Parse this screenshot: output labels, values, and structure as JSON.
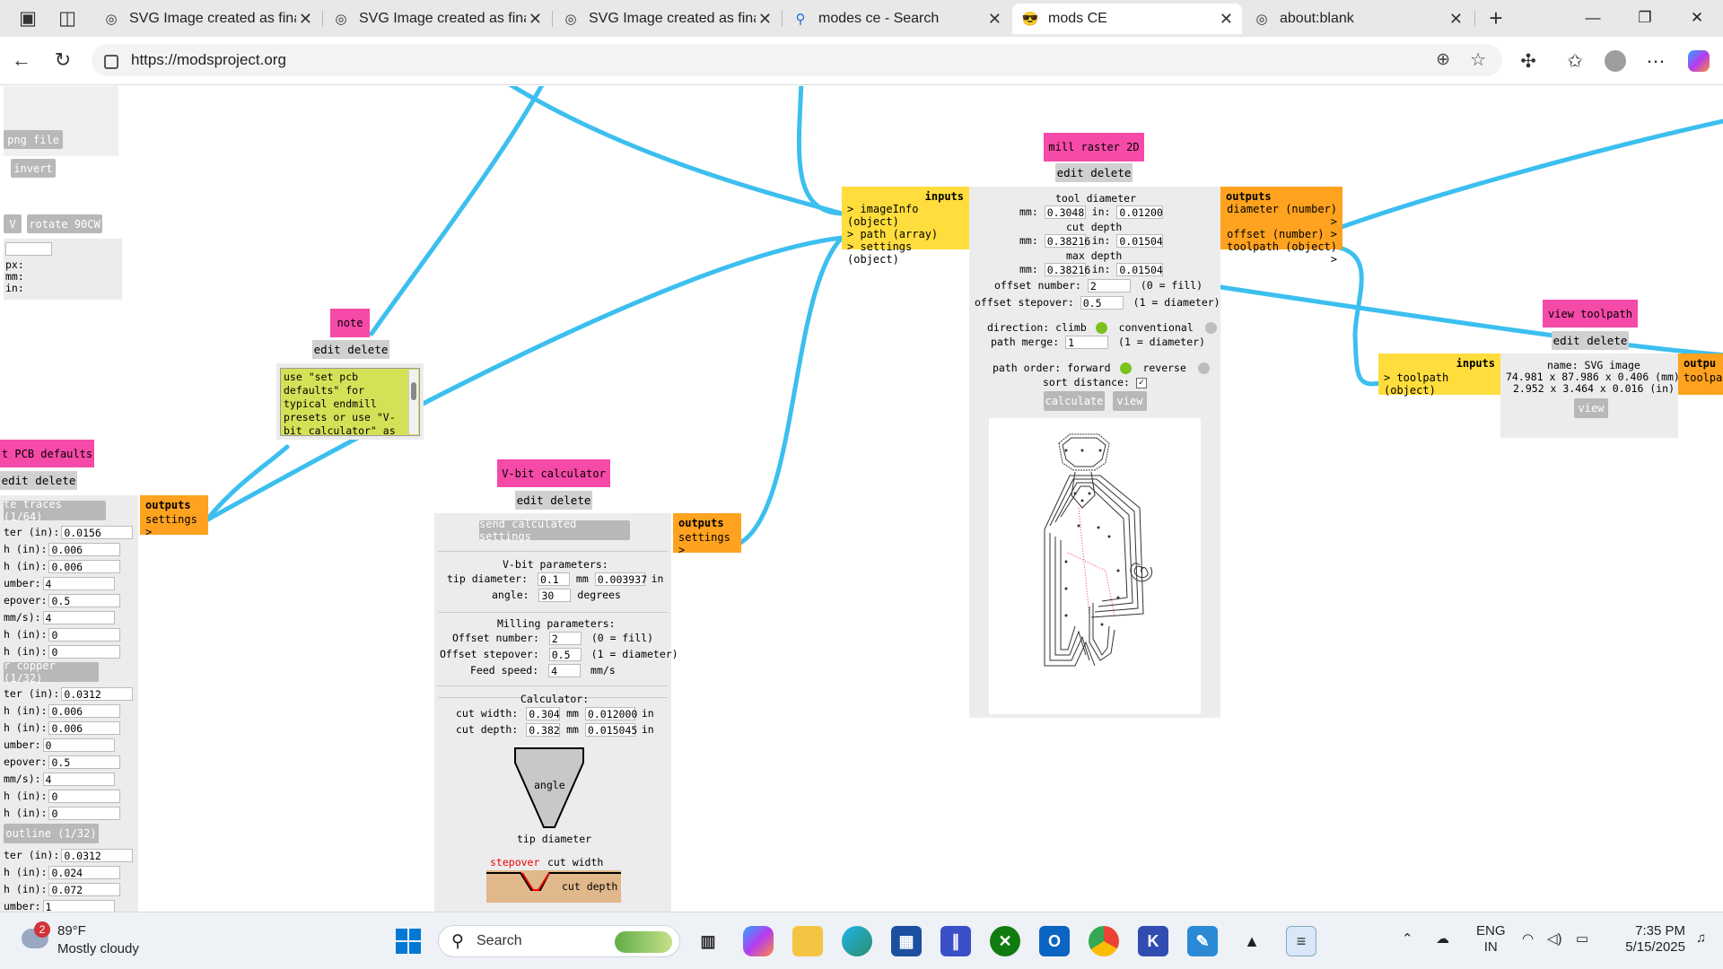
{
  "browser": {
    "tabs": [
      {
        "title": "SVG Image created as final",
        "icon": "globe-icon"
      },
      {
        "title": "SVG Image created as final",
        "icon": "globe-icon"
      },
      {
        "title": "SVG Image created as final",
        "icon": "globe-icon"
      },
      {
        "title": "modes ce - Search",
        "icon": "search-icon"
      },
      {
        "title": "mods CE",
        "icon": "sunglasses-emoji-icon",
        "active": true
      },
      {
        "title": "about:blank",
        "icon": "globe-icon"
      }
    ],
    "url": "https://modsproject.org",
    "window_controls": {
      "minimize": "—",
      "restore": "❐",
      "close": "✕"
    }
  },
  "left_partial": {
    "png_file": "png file",
    "invert": "invert",
    "v": "V",
    "rotate": "rotate 90CW",
    "units": [
      "px:",
      "mm:",
      "in:"
    ],
    "pcb_title": "t PCB defaults",
    "pcb_edit": "edit delete",
    "traces_btn": "te traces (1/64)",
    "copper_btn": "r copper (1/32)",
    "outline_btn": "outline (1/32)",
    "traces_rows": [
      {
        "label": "ter (in):",
        "value": "0.0156"
      },
      {
        "label": "h (in):",
        "value": "0.006"
      },
      {
        "label": "h (in):",
        "value": "0.006"
      },
      {
        "label": "umber:",
        "value": "4"
      },
      {
        "label": "epover:",
        "value": "0.5"
      },
      {
        "label": "mm/s):",
        "value": "4"
      },
      {
        "label": "h (in):",
        "value": "0"
      },
      {
        "label": "h (in):",
        "value": "0"
      }
    ],
    "copper_rows": [
      {
        "label": "ter (in):",
        "value": "0.0312"
      },
      {
        "label": "h (in):",
        "value": "0.006"
      },
      {
        "label": "h (in):",
        "value": "0.006"
      },
      {
        "label": "umber:",
        "value": "0"
      },
      {
        "label": "epover:",
        "value": "0.5"
      },
      {
        "label": "mm/s):",
        "value": "4"
      },
      {
        "label": "h (in):",
        "value": "0"
      },
      {
        "label": "h (in):",
        "value": "0"
      }
    ],
    "outline_rows": [
      {
        "label": "ter (in):",
        "value": "0.0312"
      },
      {
        "label": "h (in):",
        "value": "0.024"
      },
      {
        "label": "h (in):",
        "value": "0.072"
      },
      {
        "label": "umber:",
        "value": "1"
      }
    ],
    "outputs": {
      "title": "outputs",
      "items": [
        "settings >"
      ]
    }
  },
  "note": {
    "title": "note",
    "edit": "edit delete",
    "text": "use \"set pcb defaults\" for typical endmill presets or use \"V-bit calculator\" as a"
  },
  "vbit": {
    "title": "V-bit calculator",
    "edit": "edit delete",
    "send_btn": "send calculated settings",
    "vbit_params_hdr": "V-bit parameters:",
    "tip_label": "tip diameter:",
    "tip_mm": "0.1",
    "tip_in": "0.003937",
    "mm": "mm",
    "in": "in",
    "angle_label": "angle:",
    "angle_val": "30",
    "degrees": "degrees",
    "milling_hdr": "Milling parameters:",
    "offset_number_label": "Offset number:",
    "offset_number_val": "2",
    "offset_number_note": "(0 = fill)",
    "offset_stepover_label": "Offset stepover:",
    "offset_stepover_val": "0.5",
    "offset_stepover_note": "(1 = diameter)",
    "feed_label": "Feed speed:",
    "feed_val": "4",
    "feed_unit": "mm/s",
    "calc_hdr": "Calculator:",
    "cut_width_label": "cut width:",
    "cut_width_mm": "0.304",
    "cut_width_in": "0.012000",
    "cut_depth_label": "cut depth:",
    "cut_depth_mm": "0.382",
    "cut_depth_in": "0.015045",
    "diagram_angle": "angle",
    "diagram_tip": "tip diameter",
    "diagram_stepover": "stepover",
    "diagram_cut_width": "cut width",
    "diagram_cut_depth": "cut depth",
    "outputs": {
      "title": "outputs",
      "items": [
        "settings >"
      ]
    }
  },
  "mill": {
    "title": "mill raster 2D",
    "edit": "edit delete",
    "inputs": {
      "title": "inputs",
      "items": [
        "> imageInfo (object)",
        "> path (array)",
        "> settings (object)"
      ]
    },
    "outputs": {
      "title": "outputs",
      "items": [
        "diameter (number) >",
        "offset (number) >",
        "toolpath (object) >"
      ]
    },
    "tool_diameter": "tool diameter",
    "td_mm": "0.3048",
    "td_in": "0.01200",
    "cut_depth": "cut depth",
    "cd_mm": "0.38216",
    "cd_in": "0.01504",
    "max_depth": "max depth",
    "md_mm": "0.38216",
    "md_in": "0.01504",
    "mm_lbl": "mm:",
    "in_lbl": "in:",
    "offset_number_label": "offset number:",
    "offset_number_val": "2",
    "offset_number_note": "(0 = fill)",
    "offset_stepover_label": "offset stepover:",
    "offset_stepover_val": "0.5",
    "offset_stepover_note": "(1 = diameter)",
    "direction_label": "direction: climb",
    "conventional": "conventional",
    "path_merge_label": "path merge:",
    "path_merge_val": "1",
    "path_merge_note": "(1 = diameter)",
    "path_order_label": "path order: forward",
    "reverse": "reverse",
    "sort_distance": "sort distance:",
    "calculate_btn": "calculate",
    "view_btn": "view",
    "climb_color": "#7cc21f",
    "off_color": "#bdbdbd"
  },
  "view_toolpath": {
    "title": "view toolpath",
    "edit": "edit delete",
    "inputs": {
      "title": "inputs",
      "items": [
        "> toolpath (object)"
      ]
    },
    "name": "name: SVG image",
    "size_mm": "74.981 x 87.986 x 0.406 (mm)",
    "size_in": "2.952 x 3.464 x 0.016 (in)",
    "view_btn": "view",
    "outputs_partial": {
      "title": "outpu",
      "item": "toolpa"
    }
  },
  "taskbar": {
    "weather_temp": "89°F",
    "weather_desc": "Mostly cloudy",
    "weather_badge": "2",
    "search": "Search",
    "lang": "ENG",
    "region": "IN",
    "time": "7:35 PM",
    "date": "5/15/2025"
  },
  "colors": {
    "wire": "#3cbfef",
    "title_pink": "#f54aa8",
    "inputs_yellow": "#ffdd3c",
    "outputs_orange": "#ffa21f",
    "note_bg": "#d4e157"
  }
}
